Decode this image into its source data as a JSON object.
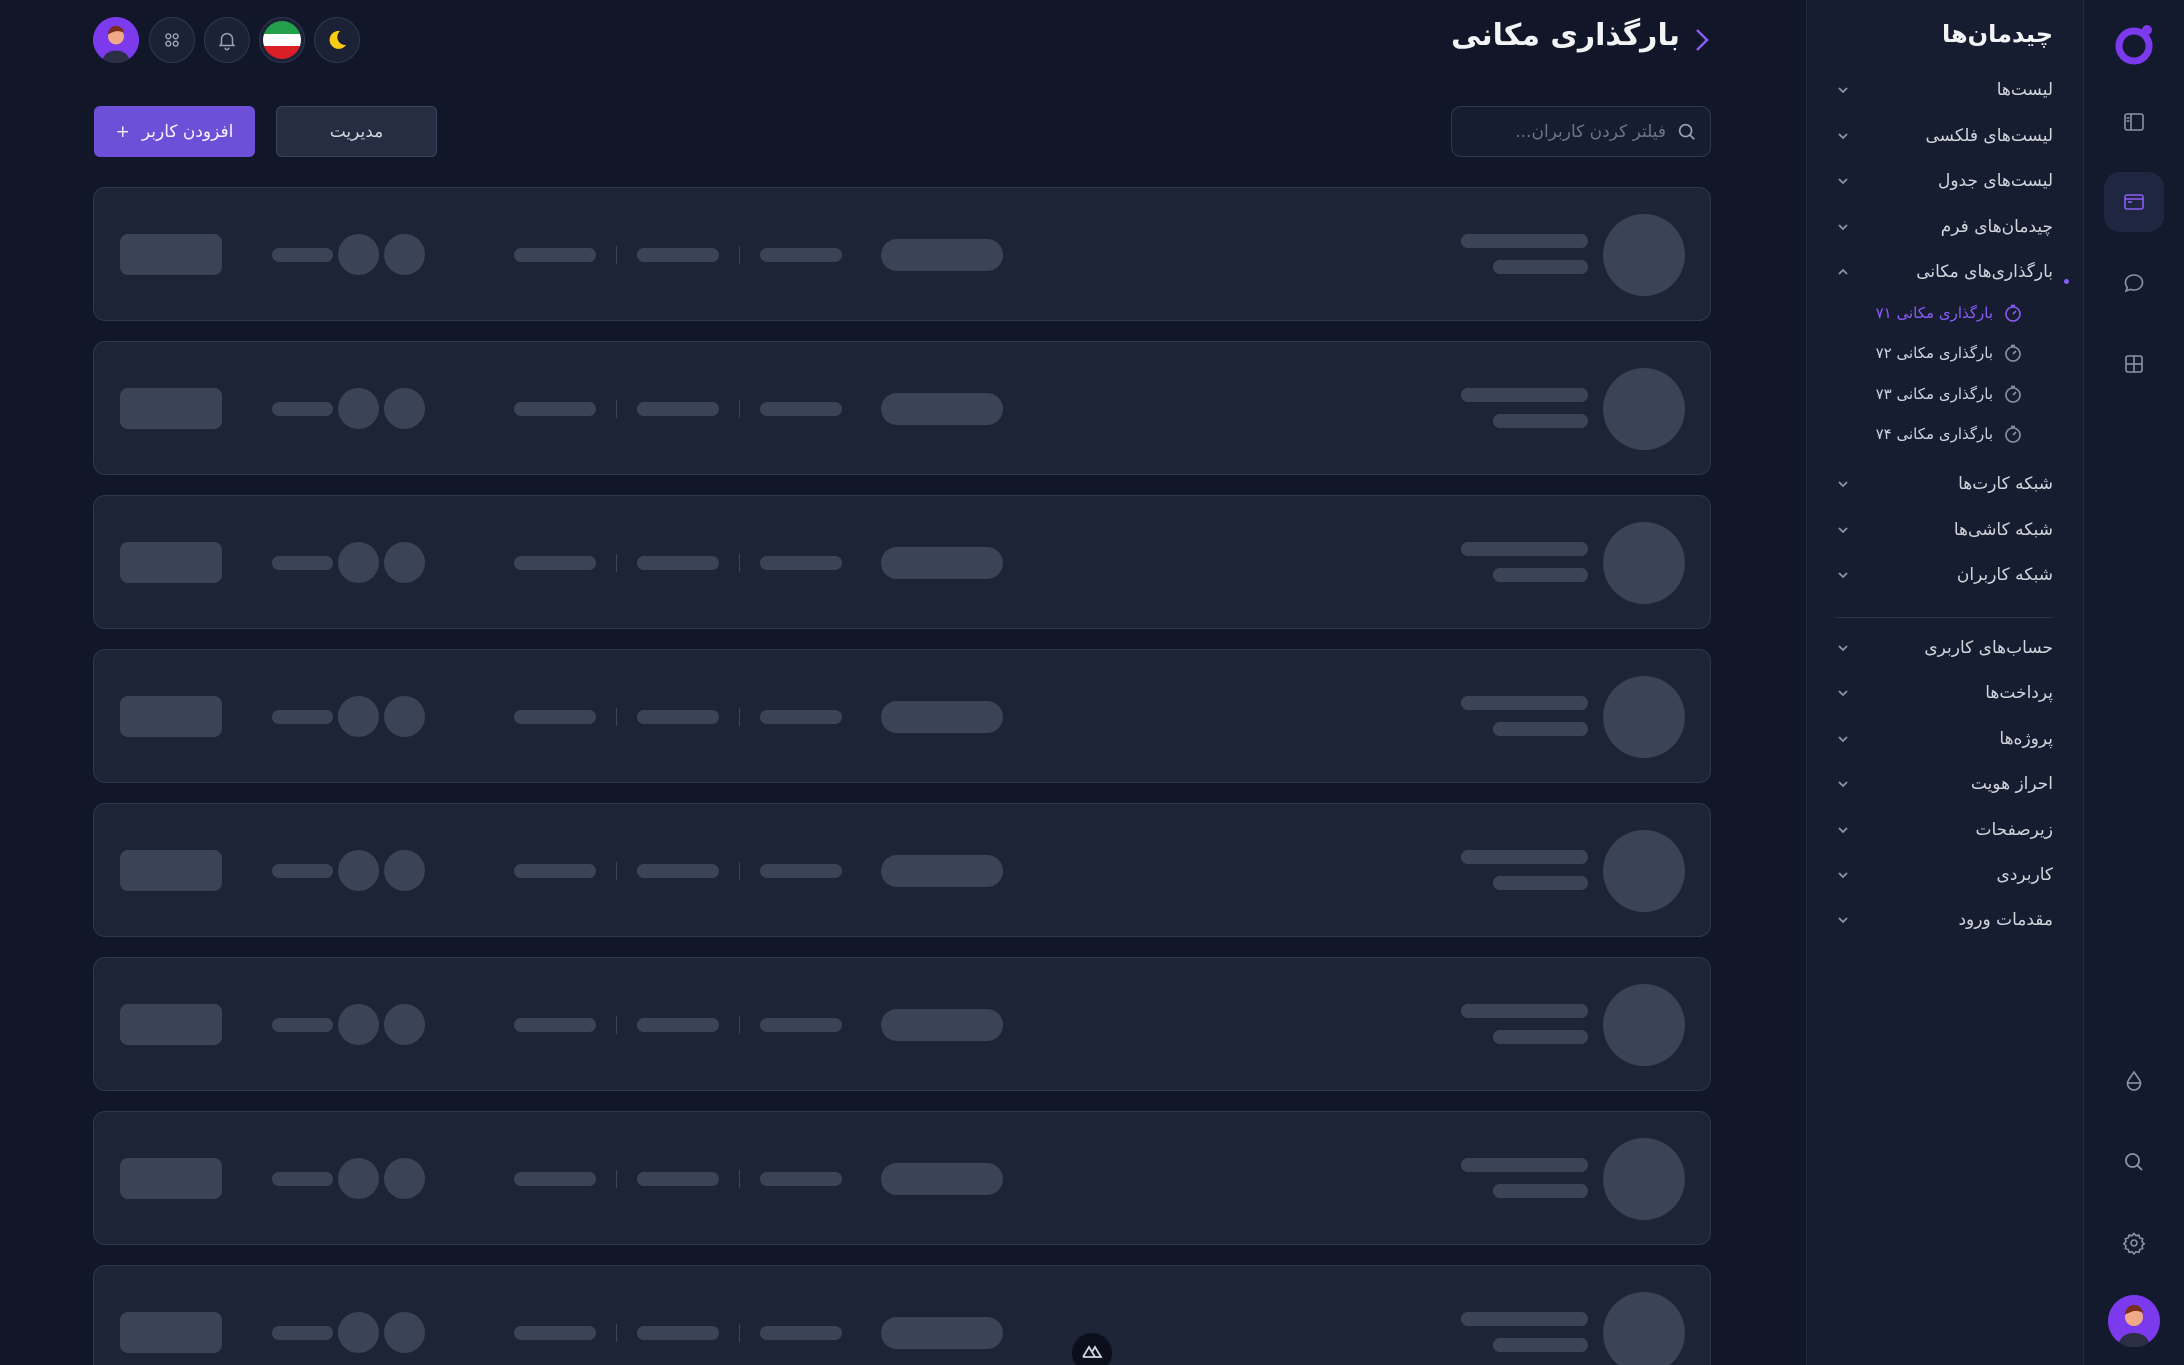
{
  "nav": {
    "title": "چیدمان‌ها",
    "items": [
      {
        "label": "لیست‌ها"
      },
      {
        "label": "لیست‌های فلکسی"
      },
      {
        "label": "لیست‌های جدول"
      },
      {
        "label": "چیدمان‌های فرم"
      },
      {
        "label": "بارگذاری‌های مکانی"
      },
      {
        "label": "شبکه کارت‌ها"
      },
      {
        "label": "شبکه کاشی‌ها"
      },
      {
        "label": "شبکه کاربران"
      },
      {
        "label": "حساب‌های کاربری"
      },
      {
        "label": "پرداخت‌ها"
      },
      {
        "label": "پروژه‌ها"
      },
      {
        "label": "احراز هویت"
      },
      {
        "label": "زیرصفحات"
      },
      {
        "label": "کاربردی"
      },
      {
        "label": "مقدمات ورود"
      }
    ],
    "sub_items": [
      {
        "label": "بارگذاری مکانی ۷۱"
      },
      {
        "label": "بارگذاری مکانی ۷۲"
      },
      {
        "label": "بارگذاری مکانی ۷۳"
      },
      {
        "label": "بارگذاری مکانی ۷۴"
      }
    ]
  },
  "header": {
    "title": "بارگذاری مکانی"
  },
  "toolbar": {
    "search_placeholder": "فیلتر کردن کاربران...",
    "search_value": "",
    "manage_label": "مدیریت",
    "add_user_label": "افزودن کاربر",
    "add_icon": "+"
  },
  "colors": {
    "accent": "#6d4fd8",
    "background": "#111628",
    "panel": "#171d31",
    "skeleton": "#3b4356"
  },
  "icons": {
    "rail": [
      "logo-icon",
      "layout-sidebar-icon",
      "window-icon",
      "chat-bubble-icon",
      "grid-icon",
      "drop-icon",
      "search-icon",
      "gear-icon",
      "user-avatar"
    ],
    "header": [
      "user-avatar",
      "apps-grid-icon",
      "bell-icon",
      "iran-flag-icon",
      "moon-icon"
    ]
  }
}
